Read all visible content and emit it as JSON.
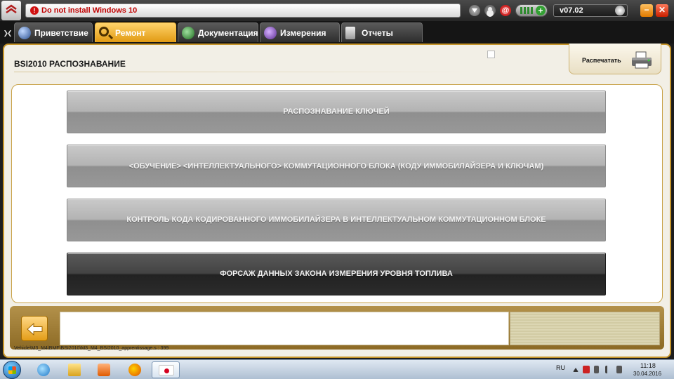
{
  "header": {
    "warning_icon": "!",
    "warning_text": "Do not install Windows 10",
    "mail_glyph": "@",
    "signal_plus": "+",
    "version": "v07.02",
    "minimize_glyph": "−",
    "close_glyph": "✕"
  },
  "tabs": [
    {
      "label": "Приветствие",
      "icon": "globe-icon"
    },
    {
      "label": "Ремонт",
      "icon": "magnifier-icon",
      "active": true
    },
    {
      "label": "Документация",
      "icon": "book-icon"
    },
    {
      "label": "Измерения",
      "icon": "wave-icon"
    },
    {
      "label": "Отчеты",
      "icon": "report-icon"
    }
  ],
  "tab_scroll_glyph": "❯❮",
  "page": {
    "title": "BSI2010  РАСПОЗНАВАНИЕ",
    "print_label": "Распечатать"
  },
  "menu": [
    {
      "label": "РАСПОЗНАВАНИЕ КЛЮЧЕЙ",
      "selected": false
    },
    {
      "label": "<ОБУЧЕНИЕ> <ИНТЕЛЛЕКТУАЛЬНОГО> КОММУТАЦИОННОГО БЛОКА (КОДУ ИММОБИЛАЙЗЕРА И КЛЮЧАМ)",
      "selected": false
    },
    {
      "label": "КОНТРОЛЬ КОДА КОДИРОВАННОГО ИММОБИЛАЙЗЕРА В ИНТЕЛЛЕКТУАЛЬНОМ КОММУТАЦИОННОМ БЛОКЕ",
      "selected": false
    },
    {
      "label": "ФОРСАЖ ДАННЫХ ЗАКОНА ИЗМЕРЕНИЯ УРОВНЯ ТОПЛИВА",
      "selected": true
    }
  ],
  "status_path": "Vehicle\\M3_M4\\BMF\\BSI2010\\M3_M4_BSI2010_apprentissage.s : 399",
  "taskbar": {
    "language": "RU",
    "time": "11:18",
    "date": "30.04.2016"
  },
  "colors": {
    "accent": "#e19a13",
    "frame_border": "#c6952a",
    "warning": "#c00000",
    "selected_button": "#2c2c2c"
  }
}
